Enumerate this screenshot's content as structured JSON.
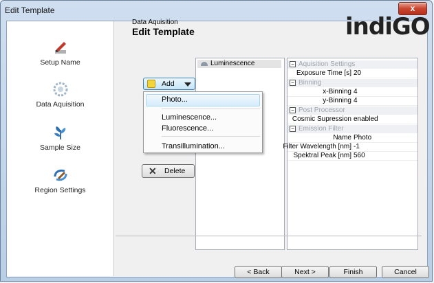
{
  "window": {
    "title": "Edit Template",
    "close_glyph": "x"
  },
  "sidebar": {
    "items": [
      {
        "label": "Setup Name",
        "icon": "pen-write-icon"
      },
      {
        "label": "Data Aquisition",
        "icon": "gear-settings-icon"
      },
      {
        "label": "Sample Size",
        "icon": "plant-icon"
      },
      {
        "label": "Region Settings",
        "icon": "region-pen-icon"
      }
    ]
  },
  "header": {
    "subtitle": "Data Aquisition",
    "title": "Edit Template",
    "logo": "indiGO"
  },
  "toolbar": {
    "add_label": "Add",
    "delete_label": "Delete"
  },
  "add_menu": {
    "items": [
      "Photo...",
      "Luminescence...",
      "Fluorescence...",
      "Transillumination..."
    ],
    "highlighted": "Photo..."
  },
  "tree": {
    "items": [
      "Luminescence"
    ]
  },
  "properties": {
    "categories": [
      {
        "name": "Aquisition Settings",
        "rows": [
          {
            "name": "Exposure Time [s]",
            "value": "20"
          }
        ]
      },
      {
        "name": "Binning",
        "rows": [
          {
            "name": "x-Binning",
            "value": "4"
          },
          {
            "name": "y-Binning",
            "value": "4"
          }
        ]
      },
      {
        "name": "Post Processor",
        "rows": [
          {
            "name": "Cosmic Supression",
            "value": "enabled"
          }
        ]
      },
      {
        "name": "Emission Filter",
        "rows": [
          {
            "name": "Name",
            "value": "Photo"
          },
          {
            "name": "Filter Wavelength [nm]",
            "value": "-1"
          },
          {
            "name": "Spektral Peak [nm]",
            "value": "560"
          }
        ]
      }
    ]
  },
  "footer": {
    "back": "< Back",
    "next": "Next >",
    "finish": "Finish",
    "cancel": "Cancel"
  }
}
